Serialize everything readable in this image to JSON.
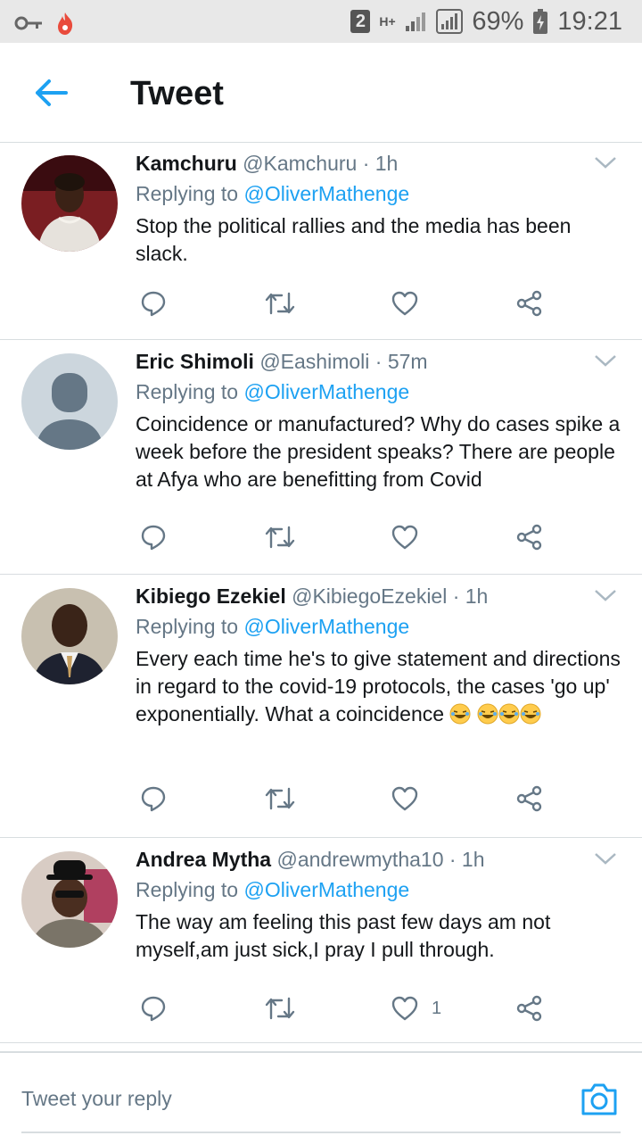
{
  "status_bar": {
    "sim": "2",
    "network": "H+",
    "battery": "69%",
    "time": "19:21"
  },
  "header": {
    "title": "Tweet"
  },
  "colors": {
    "accent": "#1da1f2",
    "secondary_text": "#657786",
    "divider": "#d8dde0"
  },
  "tweets": [
    {
      "name": "Kamchuru",
      "handle": "@Kamchuru",
      "time": "· 1h",
      "reply_prefix": "Replying to",
      "reply_mention": "@OliverMathenge",
      "text": "Stop the political rallies and the media has been slack.",
      "like_count": ""
    },
    {
      "name": "Eric Shimoli",
      "handle": "@Eashimoli",
      "time": "· 57m",
      "reply_prefix": "Replying to",
      "reply_mention": "@OliverMathenge",
      "text": "Coincidence or manufactured? Why do cases spike a week before the president speaks? There are people at Afya who are benefitting from Covid",
      "like_count": ""
    },
    {
      "name": "Kibiego Ezekiel",
      "handle": "@KibiegoEzekiel",
      "time": "· 1h",
      "reply_prefix": "Replying to",
      "reply_mention": "@OliverMathenge",
      "text": "Every each time he's to give statement and directions in regard to the covid-19 protocols, the cases 'go up' exponentially. What a coincidence",
      "like_count": ""
    },
    {
      "name": "Andrea Mytha",
      "handle": "@andrewmytha10",
      "time": "· 1h",
      "reply_prefix": "Replying to",
      "reply_mention": "@OliverMathenge",
      "text": "The way am feeling this past few days am not myself,am just sick,I pray I pull through.",
      "like_count": "1"
    }
  ],
  "reply_bar": {
    "placeholder": "Tweet your reply"
  },
  "icons": [
    "key-icon",
    "flame-icon",
    "back-arrow-icon",
    "chevron-down-icon",
    "reply-icon",
    "retweet-icon",
    "heart-icon",
    "share-icon",
    "camera-icon",
    "laughing-emoji-icon"
  ]
}
